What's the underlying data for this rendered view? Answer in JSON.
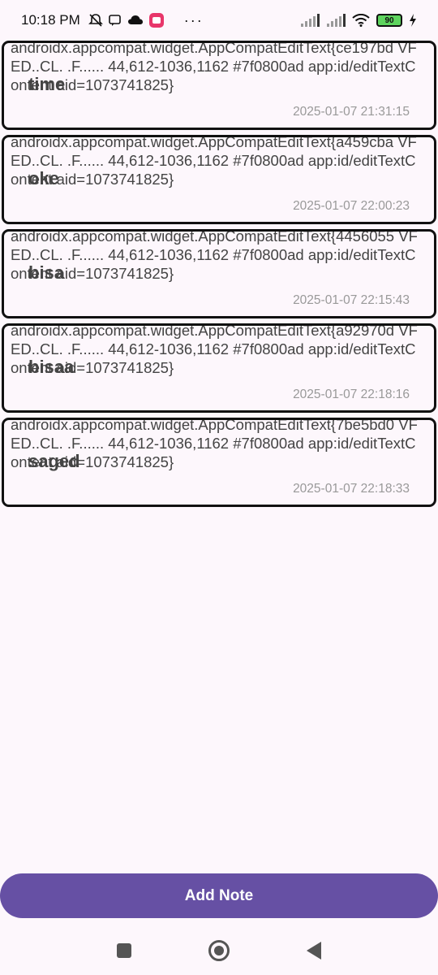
{
  "status_bar": {
    "time": "10:18 PM",
    "dots": "···",
    "battery": "90",
    "icons": [
      "mute-icon",
      "chat-icon",
      "cloud-icon",
      "app-icon",
      "signal-icon",
      "signal-icon",
      "wifi-icon",
      "charging-icon"
    ]
  },
  "notes": [
    {
      "content": "androidx.appcompat.widget.AppCompatEditText{ce197bd VFED..CL. .F...... 44,612-1036,1162 #7f0800ad app:id/editTextContent aid=1073741825}",
      "title": "time",
      "timestamp": "2025-01-07 21:31:15"
    },
    {
      "content": "androidx.appcompat.widget.AppCompatEditText{a459cba VFED..CL. .F...... 44,612-1036,1162 #7f0800ad app:id/editTextContent aid=1073741825}",
      "title": "oke",
      "timestamp": "2025-01-07 22:00:23"
    },
    {
      "content": "androidx.appcompat.widget.AppCompatEditText{4456055 VFED..CL. .F...... 44,612-1036,1162 #7f0800ad app:id/editTextContent aid=1073741825}",
      "title": "bisa",
      "timestamp": "2025-01-07 22:15:43"
    },
    {
      "content": "androidx.appcompat.widget.AppCompatEditText{a92970d VFED..CL. .F...... 44,612-1036,1162 #7f0800ad app:id/editTextContent aid=1073741825}",
      "title": "bisaa",
      "timestamp": "2025-01-07 22:18:16"
    },
    {
      "content": "androidx.appcompat.widget.AppCompatEditText{7be5bd0 VFED..CL. .F...... 44,612-1036,1162 #7f0800ad app:id/editTextContent aid=1073741825}",
      "title": "saged",
      "timestamp": "2025-01-07 22:18:33"
    }
  ],
  "add_button": {
    "label": "Add Note"
  },
  "colors": {
    "accent": "#6650a4",
    "background": "#fdf7fc"
  },
  "nav": {
    "icons": [
      "recents-icon",
      "home-icon",
      "back-icon"
    ]
  }
}
